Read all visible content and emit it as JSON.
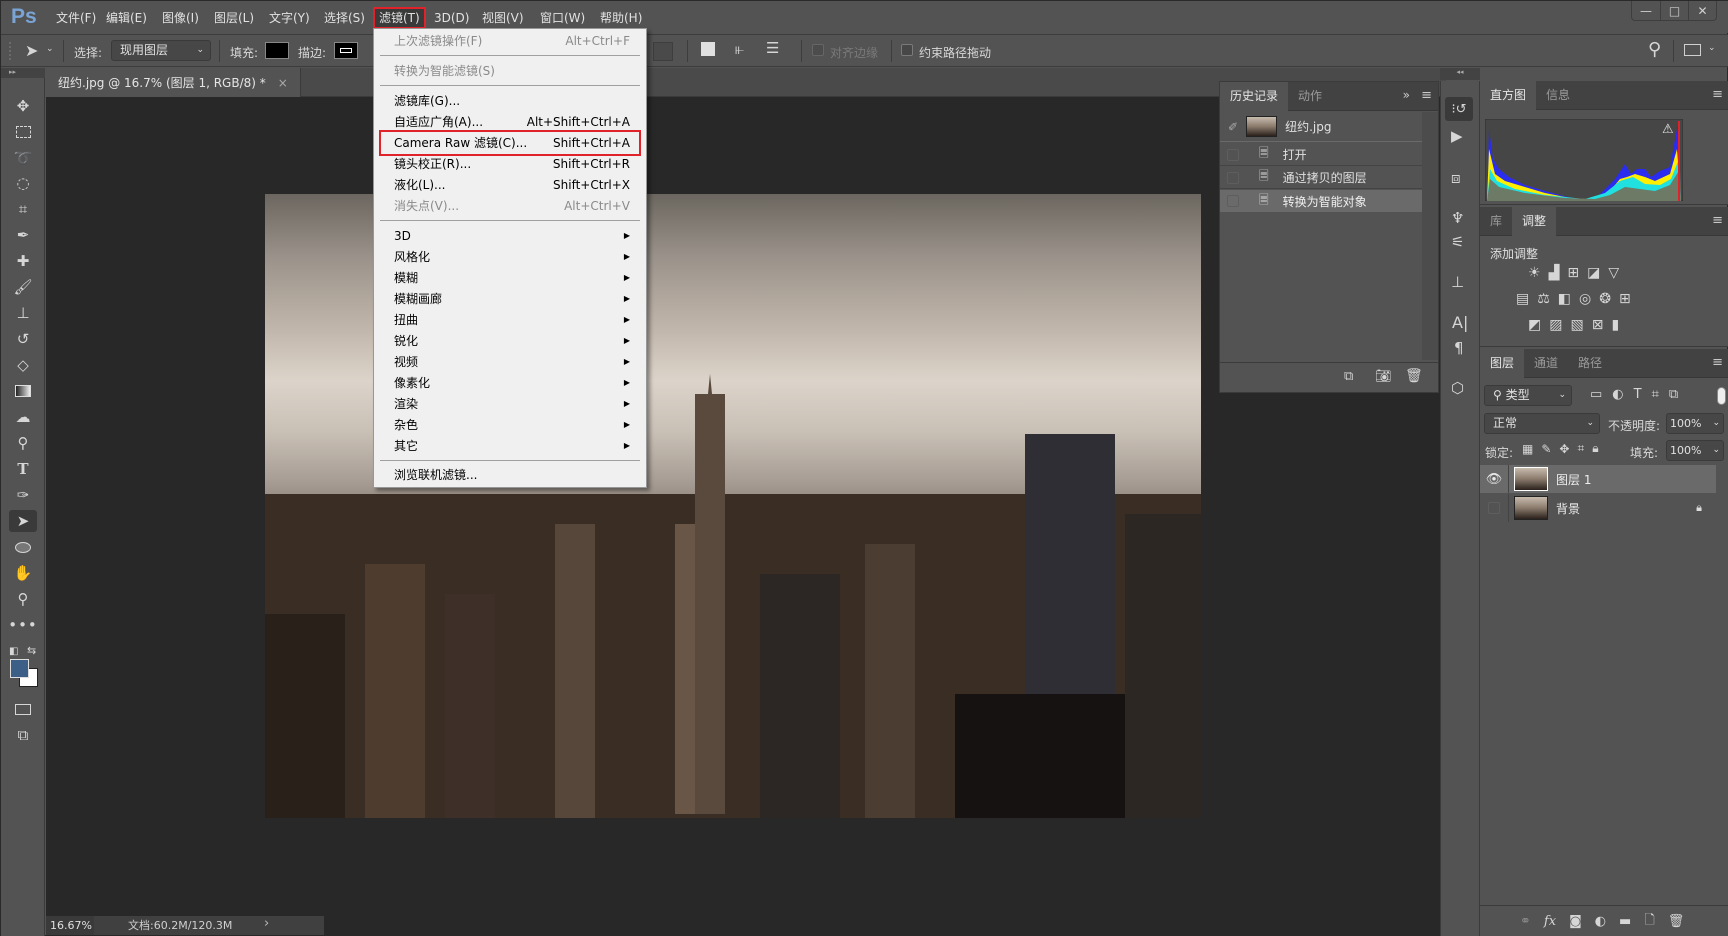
{
  "app": {
    "logo": "Ps"
  },
  "menubar": {
    "items": [
      "文件(F)",
      "编辑(E)",
      "图像(I)",
      "图层(L)",
      "文字(Y)",
      "选择(S)",
      "滤镜(T)",
      "3D(D)",
      "视图(V)",
      "窗口(W)",
      "帮助(H)"
    ],
    "active": "滤镜(T)"
  },
  "window_controls": {
    "minimize": "—",
    "maximize": "□",
    "close": "✕"
  },
  "options_bar": {
    "select_label": "选择:",
    "select_value": "现用图层",
    "fill_label": "填充:",
    "stroke_label": "描边:",
    "align_edges_label": "对齐边缘",
    "constrain_path_label": "约束路径拖动",
    "fill_color": "#000000"
  },
  "document": {
    "tab_title": "纽约.jpg @ 16.7% (图层 1, RGB/8) *",
    "tab_close": "×",
    "zoom": "16.67%",
    "doc_info": "文档:60.2M/120.3M",
    "status_arrow": "›"
  },
  "filter_menu": {
    "items": [
      {
        "label": "上次滤镜操作(F)",
        "shortcut": "Alt+Ctrl+F",
        "disabled": true
      },
      {
        "label": "转换为智能滤镜(S)",
        "shortcut": "",
        "disabled": true
      },
      {
        "label": "滤镜库(G)...",
        "shortcut": ""
      },
      {
        "label": "自适应广角(A)...",
        "shortcut": "Alt+Shift+Ctrl+A"
      },
      {
        "label": "Camera Raw 滤镜(C)...",
        "shortcut": "Shift+Ctrl+A",
        "highlighted": true
      },
      {
        "label": "镜头校正(R)...",
        "shortcut": "Shift+Ctrl+R"
      },
      {
        "label": "液化(L)...",
        "shortcut": "Shift+Ctrl+X"
      },
      {
        "label": "消失点(V)...",
        "shortcut": "Alt+Ctrl+V",
        "disabled": true
      },
      {
        "label": "3D",
        "submenu": true
      },
      {
        "label": "风格化",
        "submenu": true
      },
      {
        "label": "模糊",
        "submenu": true
      },
      {
        "label": "模糊画廊",
        "submenu": true
      },
      {
        "label": "扭曲",
        "submenu": true
      },
      {
        "label": "锐化",
        "submenu": true
      },
      {
        "label": "视频",
        "submenu": true
      },
      {
        "label": "像素化",
        "submenu": true
      },
      {
        "label": "渲染",
        "submenu": true
      },
      {
        "label": "杂色",
        "submenu": true
      },
      {
        "label": "其它",
        "submenu": true
      },
      {
        "label": "浏览联机滤镜..."
      }
    ],
    "submenu_arrow": "▶"
  },
  "history_panel": {
    "tabs": [
      "历史记录",
      "动作"
    ],
    "snapshot": "纽约.jpg",
    "states": [
      "打开",
      "通过拷贝的图层",
      "转换为智能对象"
    ],
    "selected_state": "转换为智能对象",
    "expand": "»",
    "menu": "≡"
  },
  "histogram_panel": {
    "tabs": [
      "直方图",
      "信息"
    ],
    "warning": "⚠"
  },
  "adjustments_panel": {
    "tabs": [
      "库",
      "调整"
    ],
    "heading": "添加调整"
  },
  "layers_panel": {
    "tabs": [
      "图层",
      "通道",
      "路径"
    ],
    "filter_value": "类型",
    "blend_mode": "正常",
    "opacity_label": "不透明度:",
    "opacity": "100%",
    "lock_label": "锁定:",
    "fill_label": "填充:",
    "fill": "100%",
    "layers": [
      {
        "name": "图层 1",
        "visible": true,
        "selected": true,
        "smart_object": true
      },
      {
        "name": "背景",
        "visible": false,
        "locked": true
      }
    ]
  },
  "colors": {
    "accent_red": "#e0232b",
    "foreground": "#3b5f86",
    "background": "#ffffff"
  }
}
